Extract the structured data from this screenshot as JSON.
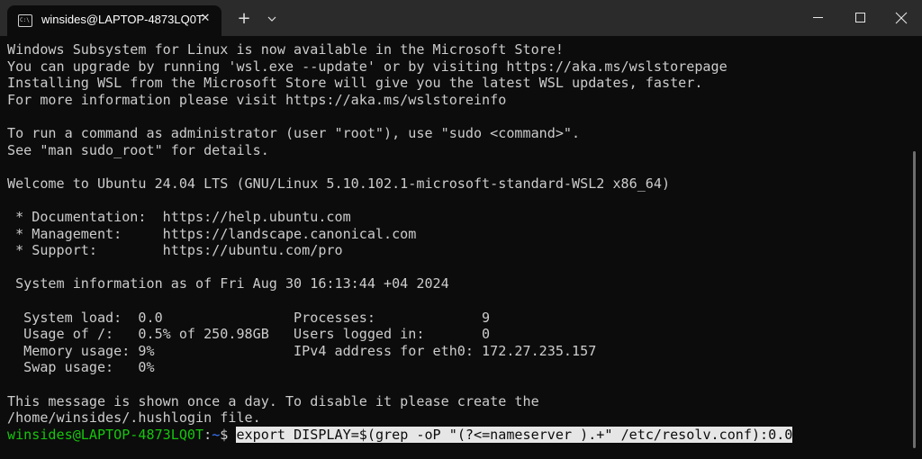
{
  "tab": {
    "title": "winsides@LAPTOP-4873LQ0T",
    "icon": "terminal-icon",
    "icon_text": "C:\\",
    "close_glyph": "✕"
  },
  "toolbar": {
    "new_tab_glyph": "+",
    "dropdown_icon": "chevron-down-icon"
  },
  "window_controls": [
    "minimize-icon",
    "maximize-icon",
    "close-icon"
  ],
  "terminal": {
    "lines": [
      "Windows Subsystem for Linux is now available in the Microsoft Store!",
      "You can upgrade by running 'wsl.exe --update' or by visiting https://aka.ms/wslstorepage",
      "Installing WSL from the Microsoft Store will give you the latest WSL updates, faster.",
      "For more information please visit https://aka.ms/wslstoreinfo",
      "",
      "To run a command as administrator (user \"root\"), use \"sudo <command>\".",
      "See \"man sudo_root\" for details.",
      "",
      "Welcome to Ubuntu 24.04 LTS (GNU/Linux 5.10.102.1-microsoft-standard-WSL2 x86_64)",
      "",
      " * Documentation:  https://help.ubuntu.com",
      " * Management:     https://landscape.canonical.com",
      " * Support:        https://ubuntu.com/pro",
      "",
      " System information as of Fri Aug 30 16:13:44 +04 2024",
      "",
      "  System load:  0.0                Processes:             9",
      "  Usage of /:   0.5% of 250.98GB   Users logged in:       0",
      "  Memory usage: 9%                 IPv4 address for eth0: 172.27.235.157",
      "  Swap usage:   0%",
      "",
      "This message is shown once a day. To disable it please create the",
      "/home/winsides/.hushlogin file."
    ],
    "prompt": {
      "user_host": "winsides@LAPTOP-4873LQ0T",
      "colon": ":",
      "path": "~",
      "symbol": "$ ",
      "command": "export DISPLAY=$(grep -oP \"(?<=nameserver ).+\" /etc/resolv.conf):0.0"
    }
  },
  "colors": {
    "background": "#0c0c0c",
    "titlebar": "#2b2b2b",
    "text": "#cccccc",
    "prompt_user": "#16c60c",
    "prompt_path": "#3b78ff",
    "selection": "#e6e6e6"
  }
}
